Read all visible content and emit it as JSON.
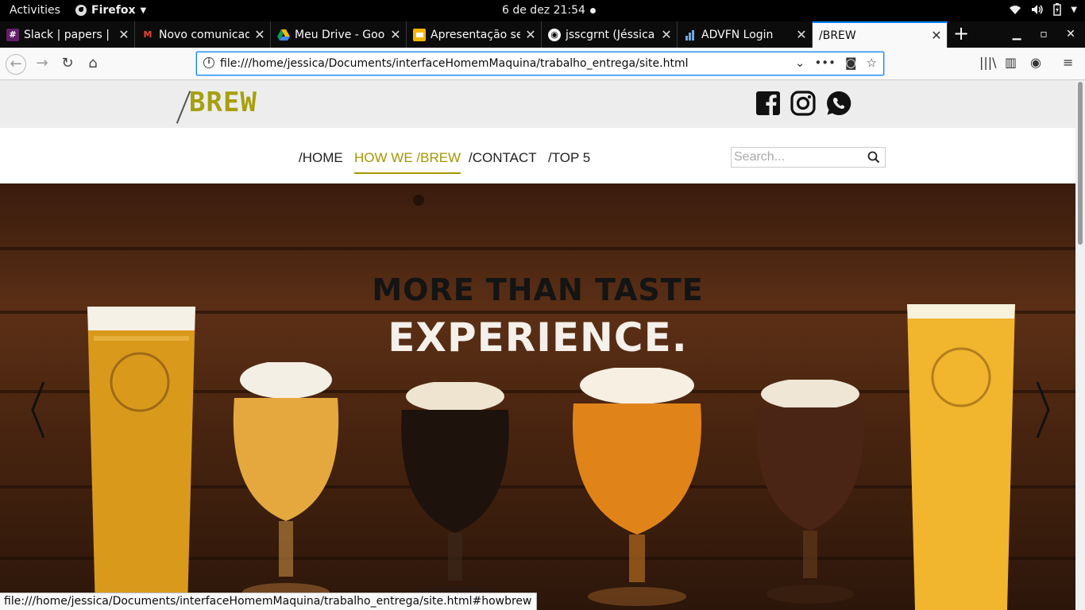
{
  "system": {
    "activities": "Activities",
    "app_name": "Firefox",
    "clock": "6 de dez  21:54"
  },
  "browser": {
    "tabs": [
      {
        "title": "Slack | papers | C",
        "icon": "slack-icon",
        "active": false
      },
      {
        "title": "Novo comunicad",
        "icon": "gmail-icon",
        "active": false
      },
      {
        "title": "Meu Drive - Goo",
        "icon": "google-drive-icon",
        "active": false
      },
      {
        "title": "Apresentação se",
        "icon": "google-slides-icon",
        "active": false
      },
      {
        "title": "jsscgrnt (Jéssica",
        "icon": "github-icon",
        "active": false
      },
      {
        "title": "ADVFN Login",
        "icon": "advfn-icon",
        "active": false
      },
      {
        "title": "/BREW",
        "icon": "",
        "active": true
      }
    ],
    "url": "file:///home/jessica/Documents/interfaceHomemMaquina/trabalho_entrega/site.html",
    "status_url": "file:///home/jessica/Documents/interfaceHomemMaquina/trabalho_entrega/site.html#howbrew"
  },
  "site": {
    "logo": "BREW",
    "logo_color": "#a6a00e",
    "accent_color": "#a69600",
    "social": [
      "facebook-icon",
      "instagram-icon",
      "whatsapp-icon"
    ],
    "menu": [
      "/HOME",
      "HOW WE /BREW",
      "/CONTACT",
      "/TOP 5"
    ],
    "active_menu": "HOW WE /BREW",
    "search_placeholder": "Search...",
    "hero": {
      "line1": "MORE THAN TASTE",
      "line2": "EXPERIENCE."
    }
  }
}
